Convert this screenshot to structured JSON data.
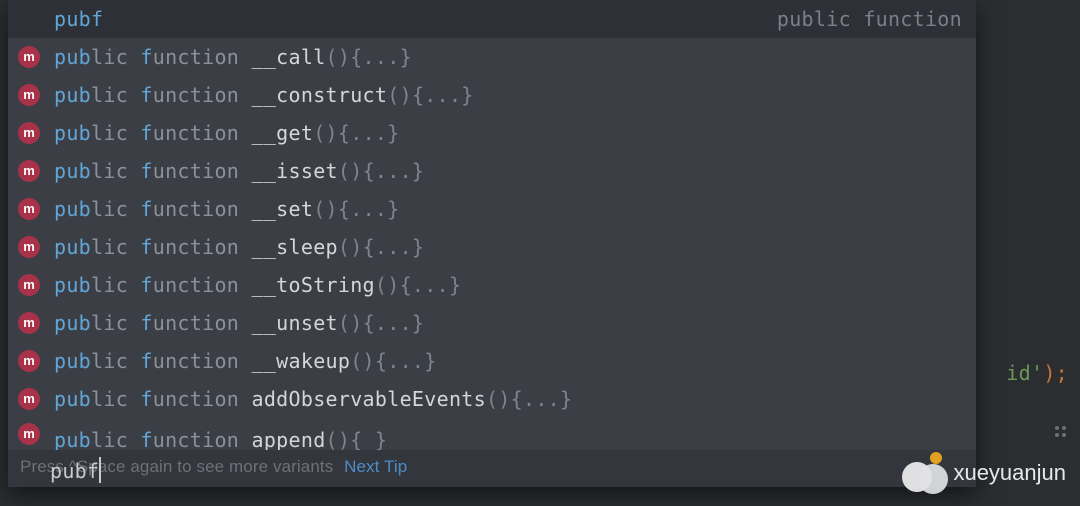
{
  "colors": {
    "popup_bg": "#3b3f45",
    "selected_bg": "#2d3036",
    "method_icon_bg": "#a7324a",
    "method_icon_fg": "#ffffff",
    "keyword_highlight": "#62a6d8",
    "text_normal": "#8b919a",
    "text_name": "#d4d6d9"
  },
  "autocomplete": {
    "query": "pubf",
    "hint": "public function",
    "hint_separator": " ",
    "icon_letter": "m",
    "suggestions": [
      {
        "highlight_prefix": "pub",
        "prefix_rest": "lic ",
        "keyword2_hi": "f",
        "keyword2_rest": "unction ",
        "name": "__call",
        "paren": "()",
        "braces": "{...}"
      },
      {
        "highlight_prefix": "pub",
        "prefix_rest": "lic ",
        "keyword2_hi": "f",
        "keyword2_rest": "unction ",
        "name": "__construct",
        "paren": "()",
        "braces": "{...}"
      },
      {
        "highlight_prefix": "pub",
        "prefix_rest": "lic ",
        "keyword2_hi": "f",
        "keyword2_rest": "unction ",
        "name": "__get",
        "paren": "()",
        "braces": "{...}"
      },
      {
        "highlight_prefix": "pub",
        "prefix_rest": "lic ",
        "keyword2_hi": "f",
        "keyword2_rest": "unction ",
        "name": "__isset",
        "paren": "()",
        "braces": "{...}"
      },
      {
        "highlight_prefix": "pub",
        "prefix_rest": "lic ",
        "keyword2_hi": "f",
        "keyword2_rest": "unction ",
        "name": "__set",
        "paren": "()",
        "braces": "{...}"
      },
      {
        "highlight_prefix": "pub",
        "prefix_rest": "lic ",
        "keyword2_hi": "f",
        "keyword2_rest": "unction ",
        "name": "__sleep",
        "paren": "()",
        "braces": "{...}"
      },
      {
        "highlight_prefix": "pub",
        "prefix_rest": "lic ",
        "keyword2_hi": "f",
        "keyword2_rest": "unction ",
        "name": "__toString",
        "paren": "()",
        "braces": "{...}"
      },
      {
        "highlight_prefix": "pub",
        "prefix_rest": "lic ",
        "keyword2_hi": "f",
        "keyword2_rest": "unction ",
        "name": "__unset",
        "paren": "()",
        "braces": "{...}"
      },
      {
        "highlight_prefix": "pub",
        "prefix_rest": "lic ",
        "keyword2_hi": "f",
        "keyword2_rest": "unction ",
        "name": "__wakeup",
        "paren": "()",
        "braces": "{...}"
      },
      {
        "highlight_prefix": "pub",
        "prefix_rest": "lic ",
        "keyword2_hi": "f",
        "keyword2_rest": "unction ",
        "name": "addObservableEvents",
        "paren": "()",
        "braces": "{...}"
      }
    ],
    "partial_suggestion": {
      "highlight_prefix": "pub",
      "prefix_rest": "lic ",
      "keyword2_hi": "f",
      "keyword2_rest": "unction ",
      "name": "append",
      "paren": "()",
      "braces": "{  }"
    },
    "tip_text": "Press ^Space again to see more variants",
    "tip_link": "Next Tip"
  },
  "editor": {
    "input_text": "pubf",
    "background_code": {
      "segment1": "id'",
      "segment2": ")",
      "segment3": ";"
    }
  },
  "watermark": {
    "text": "xueyuanjun"
  }
}
